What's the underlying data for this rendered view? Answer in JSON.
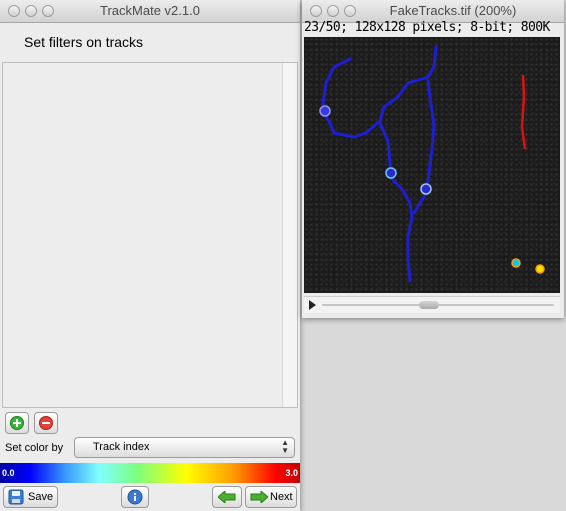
{
  "trackmate": {
    "title": "TrackMate v2.1.0",
    "heading": "Set filters on tracks",
    "set_color_label": "Set color by",
    "color_select_value": "Track index",
    "colorbar": {
      "min_label": "0.0",
      "max_label": "3.0"
    },
    "save_label": "Save",
    "next_label": "Next"
  },
  "image_window": {
    "title": "FakeTracks.tif (200%)",
    "info": "23/50; 128x128 pixels; 8-bit; 800K"
  },
  "colors": {
    "track_blue": "#1e1ed2",
    "track_red": "#e01010",
    "spot_cyan": "#6ec8ff",
    "spot_orange": "#ff9a00",
    "spot_yellow": "#ffe400"
  },
  "icons": [
    "add-filter-icon",
    "remove-filter-icon",
    "save-icon",
    "info-icon",
    "arrow-left-icon",
    "arrow-right-icon",
    "select-arrows-icon",
    "play-icon"
  ]
}
